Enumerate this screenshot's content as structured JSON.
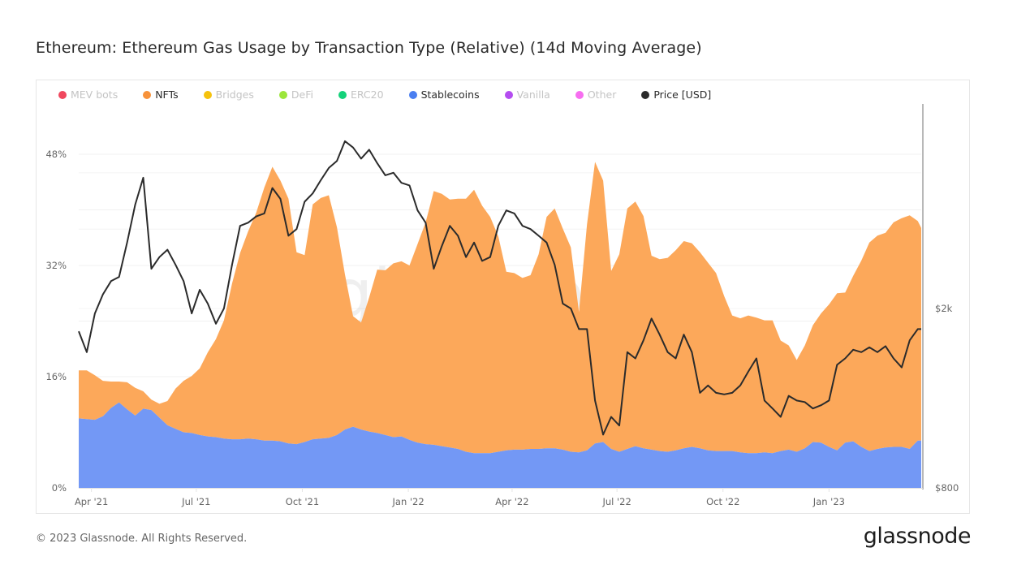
{
  "title": "Ethereum: Ethereum Gas Usage by Transaction Type (Relative) (14d Moving Average)",
  "footer": {
    "copyright": "© 2023 Glassnode. All Rights Reserved.",
    "brand": "glassnode"
  },
  "watermark": "glassnode",
  "legend": [
    {
      "label": "MEV bots",
      "color": "#f0485e",
      "active": false
    },
    {
      "label": "NFTs",
      "color": "#f7923a",
      "active": true
    },
    {
      "label": "Bridges",
      "color": "#f5c20d",
      "active": false
    },
    {
      "label": "DeFi",
      "color": "#9ce63b",
      "active": false
    },
    {
      "label": "ERC20",
      "color": "#14d27a",
      "active": false
    },
    {
      "label": "Stablecoins",
      "color": "#4a7ef0",
      "active": true
    },
    {
      "label": "Vanilla",
      "color": "#b44df0",
      "active": false
    },
    {
      "label": "Other",
      "color": "#f76ef0",
      "active": false
    },
    {
      "label": "Price [USD]",
      "color": "#2b2b2b",
      "active": true
    }
  ],
  "chart_data": {
    "type": "area",
    "title": "Ethereum: Ethereum Gas Usage by Transaction Type (Relative) (14d Moving Average)",
    "xlabel": "",
    "ylabel": "",
    "y_left": {
      "ticks": [
        "0%",
        "16%",
        "32%",
        "48%"
      ],
      "tick_values": [
        0,
        16,
        32,
        48
      ],
      "range": [
        0,
        48.8
      ]
    },
    "y_right": {
      "ticks": [
        "$800",
        "$2k"
      ],
      "tick_values": [
        800,
        2000
      ],
      "scale": "log"
    },
    "x_range": [
      "2021-03-21",
      "2023-03-22"
    ],
    "x_ticks": [
      {
        "label": "Apr '21",
        "date": "2021-04-01"
      },
      {
        "label": "Jul '21",
        "date": "2021-07-01"
      },
      {
        "label": "Oct '21",
        "date": "2021-10-01"
      },
      {
        "label": "Jan '22",
        "date": "2022-01-01"
      },
      {
        "label": "Apr '22",
        "date": "2022-04-01"
      },
      {
        "label": "Jul '22",
        "date": "2022-07-01"
      },
      {
        "label": "Oct '22",
        "date": "2022-10-01"
      },
      {
        "label": "Jan '23",
        "date": "2023-01-01"
      }
    ],
    "grid": true,
    "legend_position": "top-left",
    "stacked": true,
    "x": [
      "2021-03-21",
      "2021-03-28",
      "2021-04-04",
      "2021-04-11",
      "2021-04-18",
      "2021-04-25",
      "2021-05-02",
      "2021-05-09",
      "2021-05-16",
      "2021-05-23",
      "2021-05-30",
      "2021-06-06",
      "2021-06-13",
      "2021-06-20",
      "2021-06-27",
      "2021-07-04",
      "2021-07-11",
      "2021-07-18",
      "2021-07-25",
      "2021-08-01",
      "2021-08-08",
      "2021-08-15",
      "2021-08-22",
      "2021-08-29",
      "2021-09-05",
      "2021-09-12",
      "2021-09-19",
      "2021-09-26",
      "2021-10-03",
      "2021-10-10",
      "2021-10-17",
      "2021-10-24",
      "2021-10-31",
      "2021-11-07",
      "2021-11-14",
      "2021-11-21",
      "2021-11-28",
      "2021-12-05",
      "2021-12-12",
      "2021-12-19",
      "2021-12-26",
      "2022-01-02",
      "2022-01-09",
      "2022-01-16",
      "2022-01-23",
      "2022-01-30",
      "2022-02-06",
      "2022-02-13",
      "2022-02-20",
      "2022-02-27",
      "2022-03-06",
      "2022-03-13",
      "2022-03-20",
      "2022-03-27",
      "2022-04-03",
      "2022-04-10",
      "2022-04-17",
      "2022-04-24",
      "2022-05-01",
      "2022-05-08",
      "2022-05-15",
      "2022-05-22",
      "2022-05-29",
      "2022-06-05",
      "2022-06-12",
      "2022-06-19",
      "2022-06-26",
      "2022-07-03",
      "2022-07-10",
      "2022-07-17",
      "2022-07-24",
      "2022-07-31",
      "2022-08-07",
      "2022-08-14",
      "2022-08-21",
      "2022-08-28",
      "2022-09-04",
      "2022-09-11",
      "2022-09-18",
      "2022-09-25",
      "2022-10-02",
      "2022-10-09",
      "2022-10-16",
      "2022-10-23",
      "2022-10-30",
      "2022-11-06",
      "2022-11-13",
      "2022-11-20",
      "2022-11-27",
      "2022-12-04",
      "2022-12-11",
      "2022-12-18",
      "2022-12-25",
      "2023-01-01",
      "2023-01-08",
      "2023-01-15",
      "2023-01-22",
      "2023-01-29",
      "2023-02-05",
      "2023-02-12",
      "2023-02-19",
      "2023-02-26",
      "2023-03-05",
      "2023-03-12",
      "2023-03-19",
      "2023-03-22"
    ],
    "series": [
      {
        "name": "Stablecoins",
        "color": "#7398f5",
        "unit": "%",
        "values": [
          10.0,
          9.9,
          9.8,
          10.3,
          11.5,
          12.3,
          11.3,
          10.4,
          11.4,
          11.2,
          10.1,
          9.0,
          8.5,
          8.0,
          7.9,
          7.6,
          7.4,
          7.3,
          7.1,
          7.0,
          7.0,
          7.1,
          7.0,
          6.8,
          6.8,
          6.7,
          6.4,
          6.3,
          6.6,
          7.0,
          7.1,
          7.2,
          7.6,
          8.4,
          8.8,
          8.4,
          8.1,
          7.9,
          7.6,
          7.3,
          7.4,
          6.9,
          6.5,
          6.3,
          6.2,
          6.0,
          5.8,
          5.6,
          5.2,
          5.0,
          5.0,
          5.0,
          5.2,
          5.4,
          5.5,
          5.5,
          5.6,
          5.6,
          5.7,
          5.7,
          5.5,
          5.2,
          5.1,
          5.4,
          6.4,
          6.6,
          5.6,
          5.2,
          5.6,
          6.0,
          5.7,
          5.5,
          5.3,
          5.2,
          5.4,
          5.7,
          5.9,
          5.7,
          5.4,
          5.3,
          5.3,
          5.3,
          5.1,
          5.0,
          5.0,
          5.1,
          5.0,
          5.3,
          5.5,
          5.2,
          5.7,
          6.6,
          6.5,
          5.9,
          5.4,
          6.5,
          6.7,
          5.9,
          5.3,
          5.6,
          5.8,
          5.9,
          5.9,
          5.6,
          6.8,
          6.8
        ]
      },
      {
        "name": "NFTs",
        "color": "#fca85a",
        "unit": "%",
        "values": [
          6.9,
          7.0,
          6.4,
          5.1,
          3.8,
          3.0,
          3.9,
          4.0,
          2.5,
          1.5,
          2.0,
          3.5,
          5.8,
          7.4,
          8.2,
          9.6,
          12.1,
          14.1,
          17.0,
          22.4,
          26.8,
          29.8,
          32.6,
          36.4,
          39.4,
          37.5,
          35.2,
          27.6,
          26.9,
          33.8,
          34.6,
          34.9,
          29.9,
          22.3,
          15.9,
          15.4,
          19.3,
          23.5,
          23.7,
          25.0,
          25.2,
          25.1,
          28.6,
          31.9,
          36.5,
          36.3,
          35.7,
          36.0,
          36.4,
          37.9,
          35.6,
          34.0,
          31.0,
          25.7,
          25.4,
          24.7,
          25.0,
          28.0,
          33.3,
          34.5,
          31.8,
          29.4,
          20.2,
          32.5,
          40.5,
          37.6,
          25.6,
          28.4,
          34.6,
          35.2,
          33.4,
          27.9,
          27.6,
          27.9,
          28.8,
          29.8,
          29.3,
          28.2,
          27.0,
          25.6,
          22.3,
          19.5,
          19.3,
          19.8,
          19.5,
          19.0,
          19.1,
          15.9,
          15.0,
          13.2,
          14.8,
          16.8,
          18.6,
          20.5,
          22.6,
          21.6,
          23.8,
          26.8,
          30.0,
          30.7,
          30.9,
          32.3,
          32.9,
          33.6,
          31.6,
          30.6
        ]
      },
      {
        "name": "Price [USD]",
        "color": "#2b2b2b",
        "unit": "USD",
        "axis": "right",
        "values": [
          1780,
          1600,
          1950,
          2150,
          2300,
          2350,
          2800,
          3400,
          3900,
          2450,
          2600,
          2700,
          2500,
          2300,
          1950,
          2200,
          2050,
          1850,
          2000,
          2500,
          3050,
          3100,
          3200,
          3250,
          3700,
          3500,
          2900,
          3000,
          3450,
          3600,
          3850,
          4100,
          4250,
          4700,
          4550,
          4300,
          4500,
          4200,
          3950,
          4000,
          3800,
          3750,
          3300,
          3100,
          2450,
          2750,
          3050,
          2900,
          2600,
          2800,
          2550,
          2600,
          3050,
          3300,
          3250,
          3050,
          3000,
          2900,
          2800,
          2500,
          2050,
          2000,
          1800,
          1800,
          1250,
          1050,
          1150,
          1100,
          1600,
          1550,
          1700,
          1900,
          1750,
          1600,
          1550,
          1750,
          1600,
          1300,
          1350,
          1300,
          1290,
          1300,
          1350,
          1450,
          1550,
          1250,
          1200,
          1150,
          1280,
          1250,
          1240,
          1200,
          1220,
          1250,
          1500,
          1550,
          1620,
          1600,
          1640,
          1600,
          1650,
          1550,
          1480,
          1700,
          1800,
          1800
        ]
      }
    ]
  }
}
